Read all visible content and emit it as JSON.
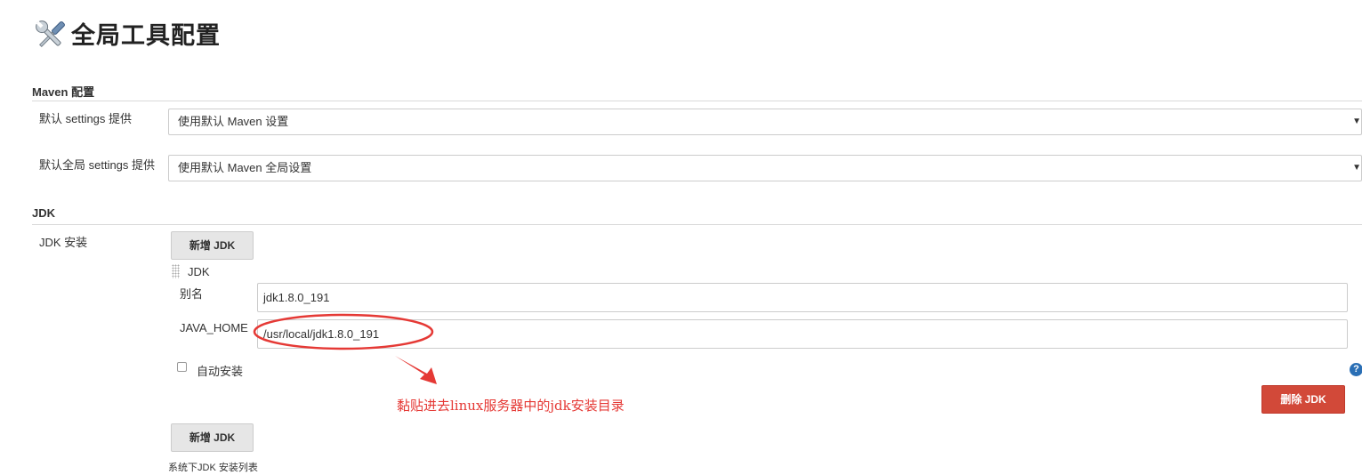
{
  "page": {
    "title": "全局工具配置",
    "icon": "tools-icon"
  },
  "maven": {
    "section_title": "Maven 配置",
    "settings_label": "默认 settings 提供",
    "settings_value": "使用默认 Maven 设置",
    "global_settings_label": "默认全局 settings 提供",
    "global_settings_value": "使用默认 Maven 全局设置"
  },
  "jdk": {
    "section_title": "JDK",
    "installations_label": "JDK 安装",
    "add_button": "新增 JDK",
    "entry_title": "JDK",
    "alias_label": "别名",
    "alias_value": "jdk1.8.0_191",
    "java_home_label": "JAVA_HOME",
    "java_home_value": "/usr/local/jdk1.8.0_191",
    "auto_install_label": "自动安装",
    "auto_install_checked": false,
    "delete_button": "删除 JDK",
    "add_button_bottom": "新增 JDK",
    "list_caption": "系统下JDK 安装列表"
  },
  "annotation": {
    "text": "黏贴进去linux服务器中的jdk安装目录",
    "color": "#e53935"
  },
  "colors": {
    "delete_button_bg": "#d24939",
    "help_icon": "#2a6fb5"
  }
}
